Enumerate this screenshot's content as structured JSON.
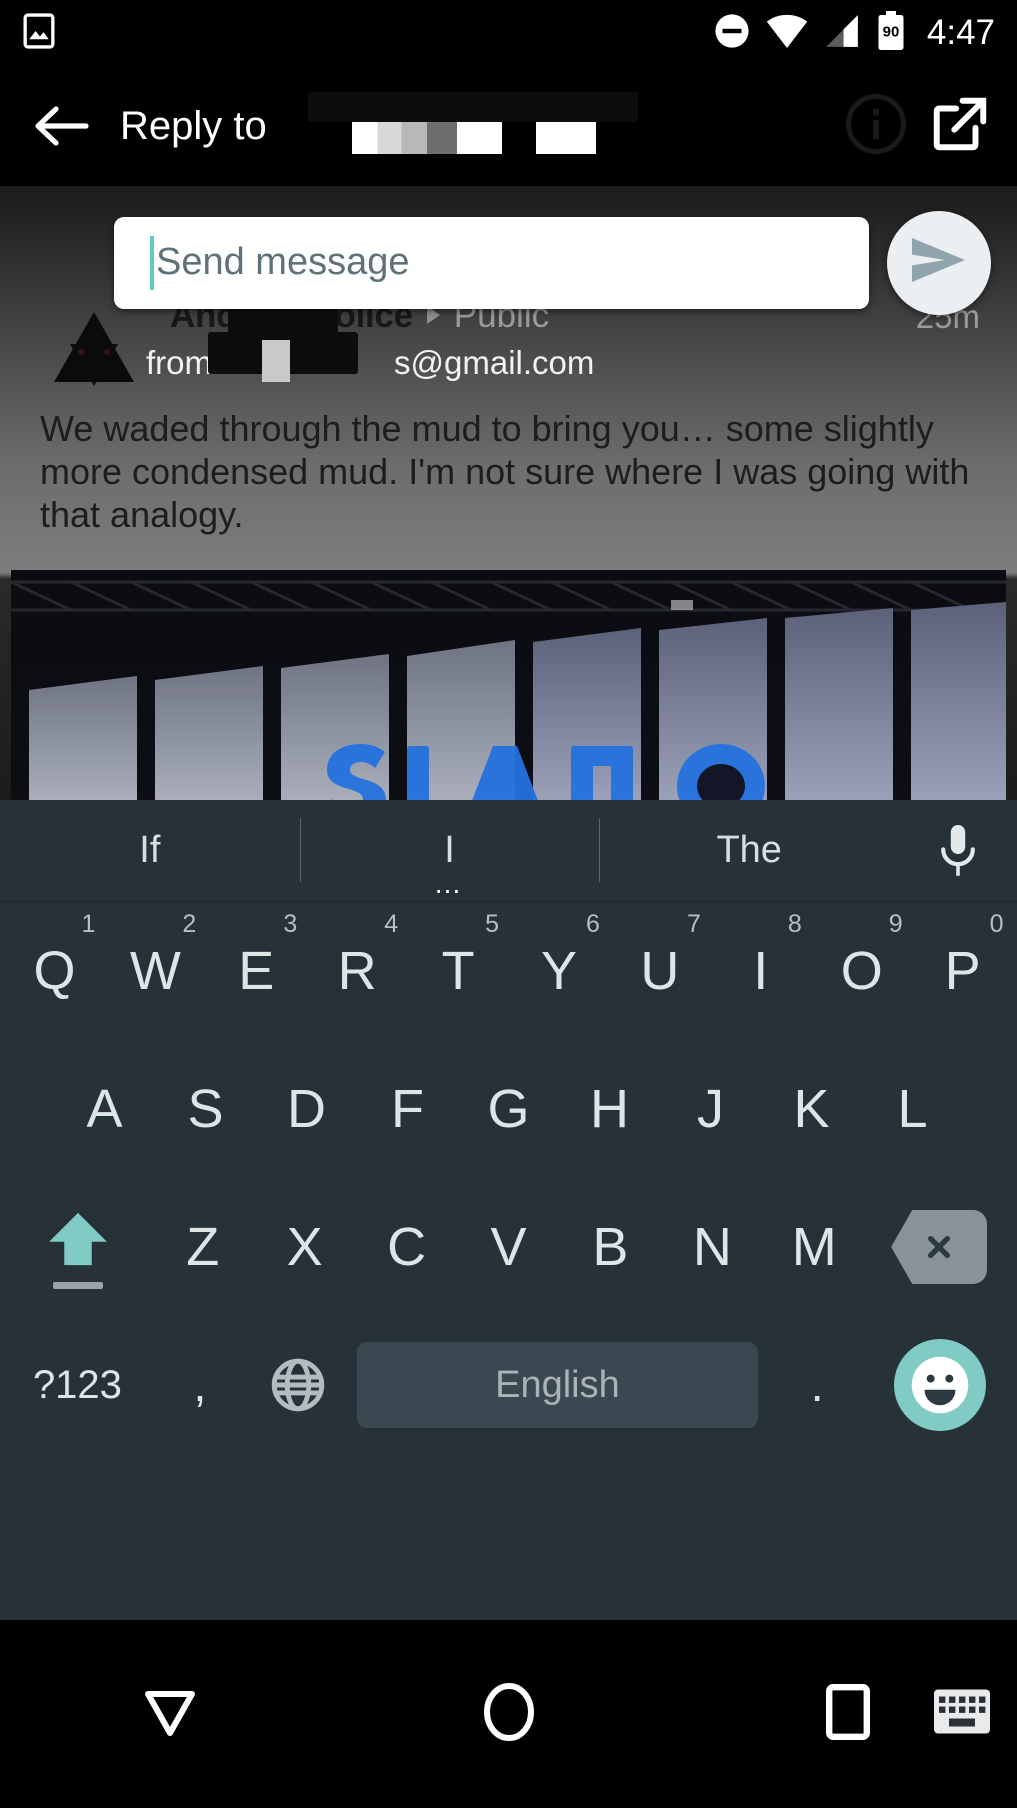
{
  "status_bar": {
    "time": "4:47",
    "battery_level": "90",
    "icons": [
      "photo-icon",
      "do-not-disturb-icon",
      "wifi-icon",
      "signal-icon",
      "battery-icon"
    ]
  },
  "app_bar": {
    "back_label": "back-arrow",
    "title": "Reply to",
    "title_redacted": true,
    "actions": [
      {
        "name": "info-icon",
        "label": "Info"
      },
      {
        "name": "open-in-new-icon",
        "label": "Open in new"
      }
    ]
  },
  "compose": {
    "placeholder": "Send message",
    "value": "",
    "send_label": "Send"
  },
  "post": {
    "author": "Android Police",
    "audience": "Public",
    "timestamp": "25m",
    "from_prefix": "from",
    "from_email": "s@gmail.com",
    "body": "We waded through the mud to bring you… some slightly more condensed mud. I'm not sure where I was going with that analogy.",
    "has_photo": true
  },
  "keyboard": {
    "suggestions": [
      "If",
      "I",
      "The"
    ],
    "suggestion_more": "…",
    "mic_label": "voice-input",
    "row1": [
      {
        "key": "Q",
        "hint": "1"
      },
      {
        "key": "W",
        "hint": "2"
      },
      {
        "key": "E",
        "hint": "3"
      },
      {
        "key": "R",
        "hint": "4"
      },
      {
        "key": "T",
        "hint": "5"
      },
      {
        "key": "Y",
        "hint": "6"
      },
      {
        "key": "U",
        "hint": "7"
      },
      {
        "key": "I",
        "hint": "8"
      },
      {
        "key": "O",
        "hint": "9"
      },
      {
        "key": "P",
        "hint": "0"
      }
    ],
    "row2": [
      "A",
      "S",
      "D",
      "F",
      "G",
      "H",
      "J",
      "K",
      "L"
    ],
    "row3": [
      "Z",
      "X",
      "C",
      "V",
      "B",
      "N",
      "M"
    ],
    "shift_label": "shift",
    "backspace_label": "backspace",
    "symbols_label": "?123",
    "comma_label": ",",
    "period_label": ".",
    "globe_label": "language-switch",
    "space_label": "English",
    "emoji_label": "emoji",
    "shift_active": true
  },
  "nav_bar": {
    "back_label": "back",
    "home_label": "home",
    "recents_label": "recents",
    "keyboard_label": "keyboard-switcher"
  },
  "colors": {
    "keyboard_bg": "#263238",
    "accent_teal": "#80cbc4",
    "caret": "#63c8bd",
    "send_fab_bg": "#eceff1",
    "send_icon": "#90a4ae",
    "space_key": "#3b4851",
    "key_text": "#dfe4e6"
  }
}
